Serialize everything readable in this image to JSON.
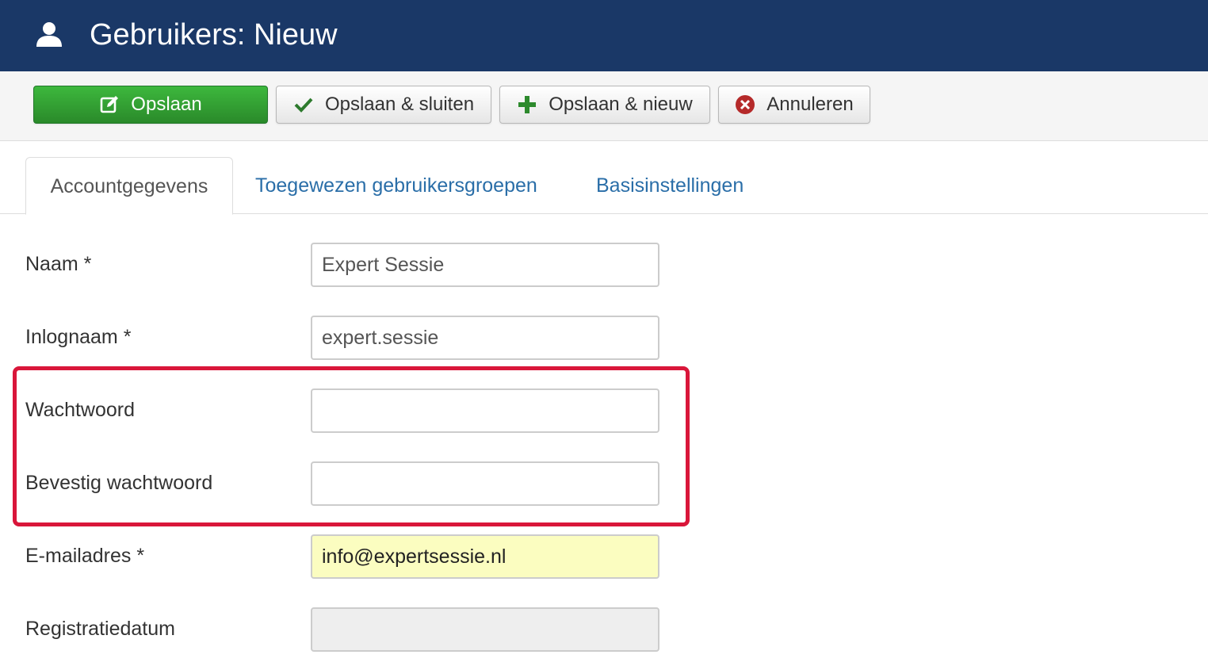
{
  "header": {
    "icon": "user-icon",
    "title": "Gebruikers: Nieuw",
    "bg_color": "#1a3867"
  },
  "toolbar": {
    "save_label": "Opslaan",
    "save_close_label": "Opslaan & sluiten",
    "save_new_label": "Opslaan & nieuw",
    "cancel_label": "Annuleren"
  },
  "tabs": [
    {
      "label": "Accountgegevens",
      "active": true
    },
    {
      "label": "Toegewezen gebruikersgroepen",
      "active": false
    },
    {
      "label": "Basisinstellingen",
      "active": false
    }
  ],
  "form": {
    "name": {
      "label": "Naam *",
      "value": "Expert Sessie"
    },
    "username": {
      "label": "Inlognaam *",
      "value": "expert.sessie"
    },
    "password": {
      "label": "Wachtwoord",
      "value": ""
    },
    "password_confirm": {
      "label": "Bevestig wachtwoord",
      "value": ""
    },
    "email": {
      "label": "E-mailadres *",
      "value": "info@expertsessie.nl"
    },
    "register_date": {
      "label": "Registratiedatum",
      "value": ""
    }
  },
  "colors": {
    "save_button": "#2a8a2a",
    "highlight": "#d9163a",
    "link": "#2a6ea8"
  }
}
